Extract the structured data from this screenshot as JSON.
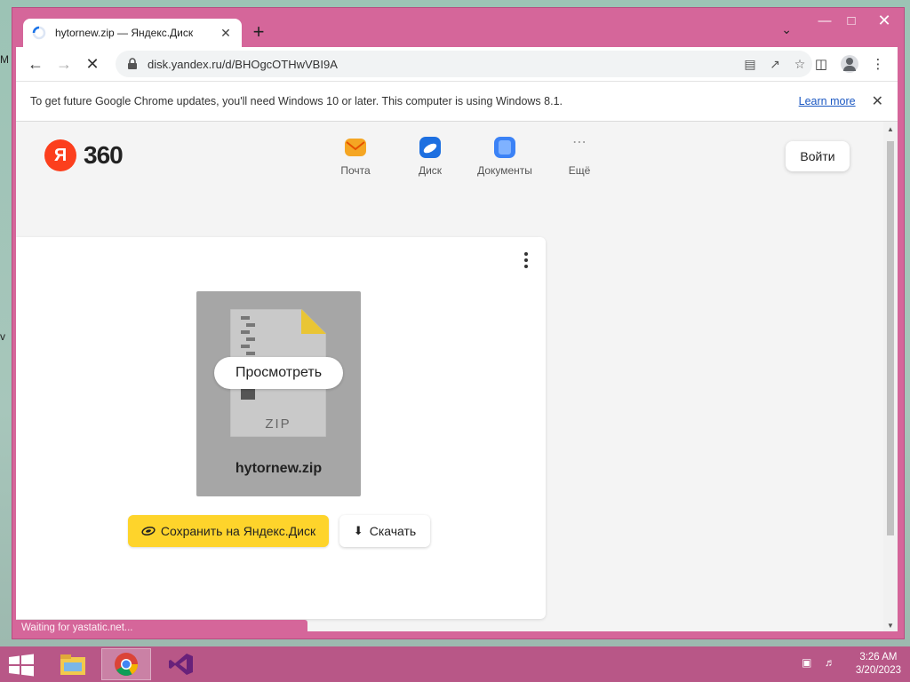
{
  "browser": {
    "tab": {
      "title": "hytornew.zip — Яндекс.Диск"
    },
    "url": "disk.yandex.ru/d/BHOgcOTHwVBI9A",
    "infobar": {
      "message": "To get future Google Chrome updates, you'll need Windows 10 or later. This computer is using Windows 8.1.",
      "link": "Learn more"
    },
    "status": "Waiting for yastatic.net..."
  },
  "header": {
    "logo_letter": "Я",
    "logo_text": "360",
    "services": [
      {
        "label": "Почта",
        "icon": "mail-icon",
        "color": "#f5a623"
      },
      {
        "label": "Диск",
        "icon": "disk-icon",
        "color": "#1d6fe0"
      },
      {
        "label": "Документы",
        "icon": "documents-icon",
        "color": "#3b82f6"
      },
      {
        "label": "Ещё",
        "icon": "more-icon"
      }
    ],
    "login": "Войти"
  },
  "file": {
    "name": "hytornew.zip",
    "type_label": "ZIP",
    "preview_button": "Просмотреть"
  },
  "actions": {
    "save": "Сохранить на Яндекс.Диск",
    "download": "Скачать"
  },
  "taskbar": {
    "time": "3:26 AM",
    "date": "3/20/2023"
  },
  "colors": {
    "accent_yellow": "#fed42b",
    "window_frame": "#d5669a",
    "yandex_red": "#fc3f1d"
  }
}
